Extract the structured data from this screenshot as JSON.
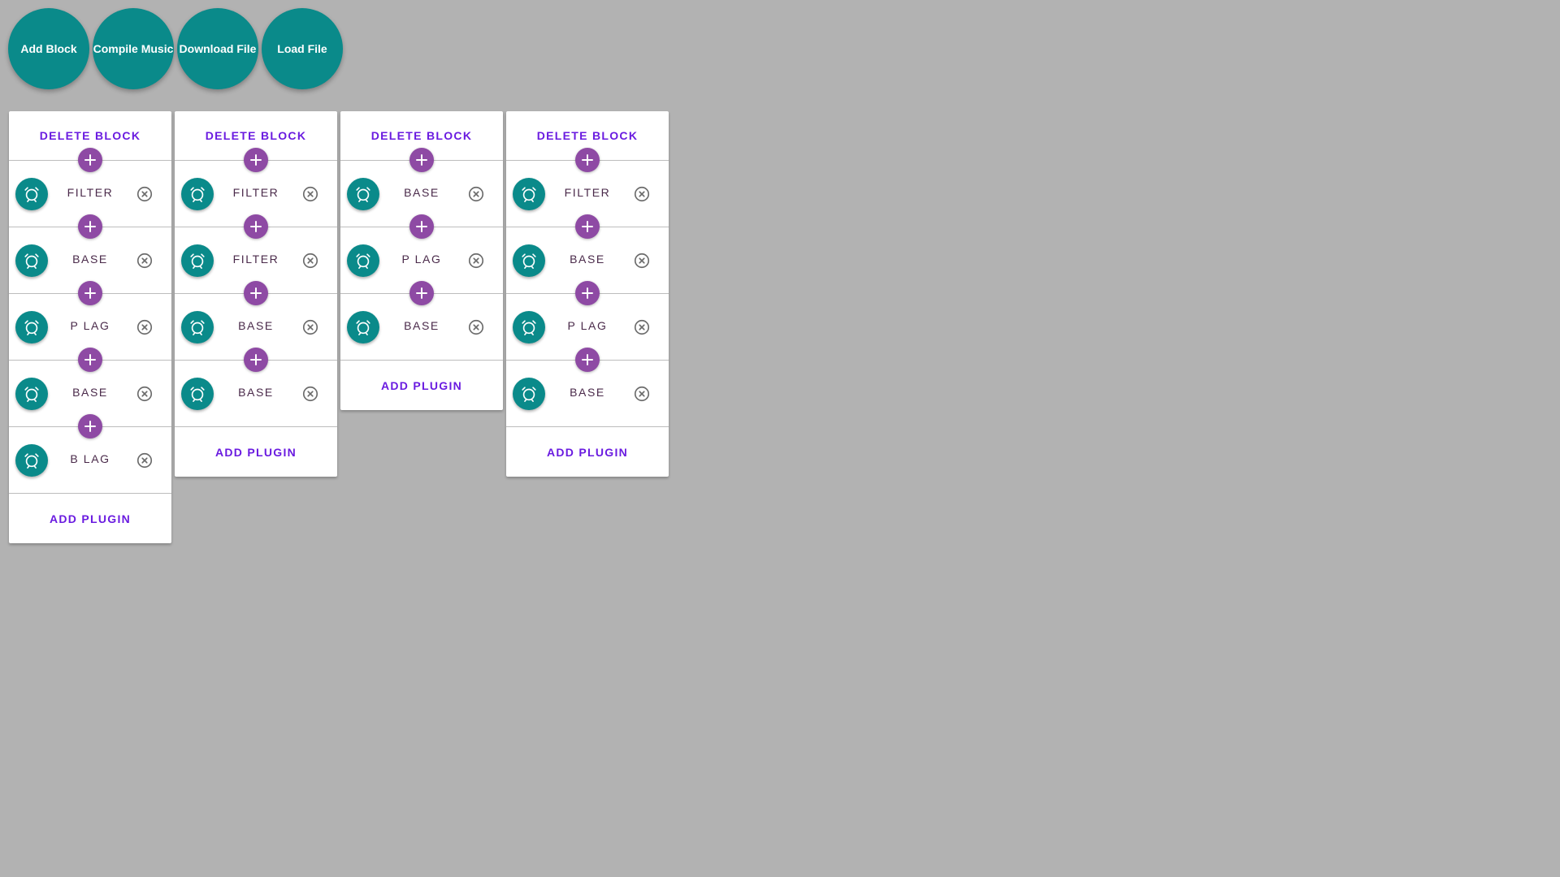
{
  "toolbar": {
    "add_block": "Add Block",
    "compile_music": "Compile Music",
    "download_file": "Download File",
    "load_file": "Load File"
  },
  "colors": {
    "background": "#b2b2b2",
    "teal": "#0a8a8a",
    "purple": "#8e4aa4",
    "accent_text": "#6a1be0"
  },
  "icons": {
    "plugin": "alarm-clock-icon",
    "insert": "plus-icon",
    "remove": "close-circle-icon"
  },
  "blocks": [
    {
      "delete_label": "DELETE BLOCK",
      "plugins": [
        "FILTER",
        "BASE",
        "P LAG",
        "BASE",
        "B LAG"
      ],
      "add_label": "ADD PLUGIN"
    },
    {
      "delete_label": "DELETE BLOCK",
      "plugins": [
        "FILTER",
        "FILTER",
        "BASE",
        "BASE"
      ],
      "add_label": "ADD PLUGIN"
    },
    {
      "delete_label": "DELETE BLOCK",
      "plugins": [
        "BASE",
        "P LAG",
        "BASE"
      ],
      "add_label": "ADD PLUGIN"
    },
    {
      "delete_label": "DELETE BLOCK",
      "plugins": [
        "FILTER",
        "BASE",
        "P LAG",
        "BASE"
      ],
      "add_label": "ADD PLUGIN"
    }
  ]
}
